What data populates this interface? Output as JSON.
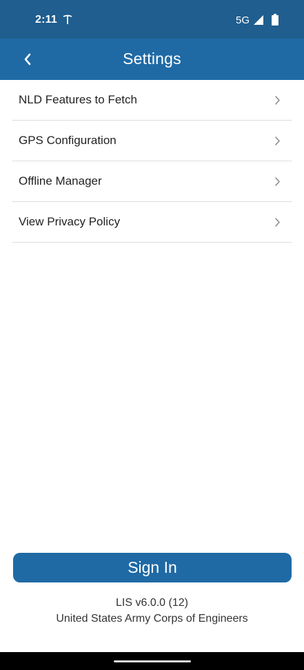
{
  "status_bar": {
    "time": "2:11",
    "network": "5G",
    "icons": [
      "carrier-icon",
      "signal-icon",
      "battery-icon"
    ]
  },
  "app_bar": {
    "title": "Settings",
    "back_icon": "chevron-left-icon"
  },
  "settings": {
    "items": [
      {
        "label": "NLD Features to Fetch",
        "icon": "chevron-right-icon"
      },
      {
        "label": "GPS Configuration",
        "icon": "chevron-right-icon"
      },
      {
        "label": "Offline Manager",
        "icon": "chevron-right-icon"
      },
      {
        "label": "View Privacy Policy",
        "icon": "chevron-right-icon"
      }
    ]
  },
  "sign_in": {
    "label": "Sign In"
  },
  "footer": {
    "version": "LIS v6.0.0 (12)",
    "organization": "United States Army Corps of Engineers"
  },
  "colors": {
    "status_bar": "#1f5e8f",
    "primary": "#1f6aa5",
    "divider": "#dcdcdc",
    "text": "#222222"
  }
}
